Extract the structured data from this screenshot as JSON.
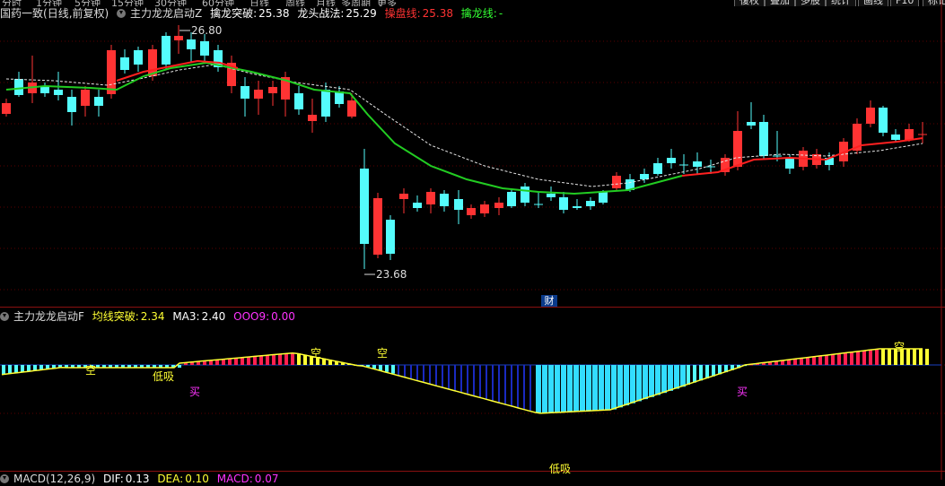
{
  "top_tabs": [
    "分时",
    "1分钟",
    "5分钟",
    "15分钟",
    "30分钟",
    "60分钟",
    "日线",
    "周线",
    "月线",
    "多周期",
    "更多"
  ],
  "top_buttons": [
    "復权",
    "叠加",
    "多股",
    "统计",
    "画线",
    "F10",
    "标记"
  ],
  "header": {
    "stock": "国药一致",
    "period": "(日线,前复权)",
    "indicator": "主力龙龙启动Z",
    "qinglong_label": "擒龙突破:",
    "qinglong_value": "25.38",
    "longtou_label": "龙头战法:",
    "longtou_value": "25.29",
    "caopan_label": "操盘线:",
    "caopan_value": "25.38",
    "qinlong_line_label": "擒龙线:",
    "qinlong_line_value": "-"
  },
  "price_annotations": {
    "high": "26.80",
    "low": "23.68"
  },
  "cai_badge": "财",
  "sub_header": {
    "indicator": "主力龙龙启动F",
    "junxian_label": "均线突破:",
    "junxian_value": "2.34",
    "ma3_label": "MA3:",
    "ma3_value": "2.40",
    "ooo9_label": "OOO9:",
    "ooo9_value": "0.00"
  },
  "sub_marks": {
    "kong1": "空",
    "kong2": "空",
    "kong3": "空",
    "kong4": "空",
    "dixi1": "低吸",
    "dixi2": "低吸",
    "mai1": "买",
    "mai2": "买"
  },
  "macd_header": {
    "name": "MACD(12,26,9)",
    "dif_label": "DIF:",
    "dif_value": "0.13",
    "dea_label": "DEA:",
    "dea_value": "0.10",
    "macd_label": "MACD:",
    "macd_value": "0.07"
  },
  "colors": {
    "up": "#ff3333",
    "down": "#54fcfc",
    "green_line": "#22cc22",
    "red_line": "#ff2020",
    "yellow": "#ffff33",
    "magenta": "#ff33ff",
    "header_red": "#ff3333",
    "header_green": "#33ff33"
  }
}
